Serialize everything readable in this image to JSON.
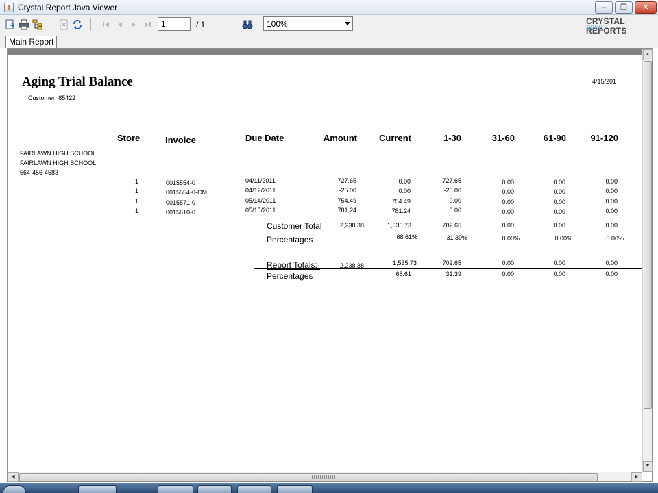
{
  "window": {
    "title": "Crystal Report Java Viewer",
    "minimize_glyph": "–",
    "maximize_glyph": "❐",
    "close_glyph": "✕"
  },
  "toolbar": {
    "icons": [
      "export-icon",
      "print-icon",
      "group-tree-icon",
      "close-view-icon",
      "refresh-icon",
      "first-page-icon",
      "previous-page-icon",
      "next-page-icon",
      "last-page-icon",
      "search-icon"
    ],
    "page_value": "1",
    "page_total": "/ 1",
    "zoom_value": "100%",
    "brand_line1": "CRYSTAL REPORTS",
    "brand_line2": "2008"
  },
  "tabs": [
    {
      "label": "Main Report"
    }
  ],
  "report": {
    "title": "Aging Trial Balance",
    "date": "4/15/201",
    "customer_param": "Customer=85422",
    "headers": [
      "Store",
      "Invoice",
      "Due Date",
      "Amount",
      "Current",
      "1-30",
      "31-60",
      "61-90",
      "91-120"
    ],
    "customer_lines": [
      "FAIRLAWN HIGH SCHOOL",
      "FAIRLAWN HIGH SCHOOL",
      "564-456-4583"
    ],
    "rows": [
      {
        "store": "1",
        "invoice": "0015554-0",
        "due": "04/11/2011",
        "amount": "727.65",
        "current": "0.00",
        "d1_30": "727.65",
        "d31_60": "0.00",
        "d61_90": "0.00",
        "d91_120": "0.00"
      },
      {
        "store": "1",
        "invoice": "0015554-0-CM",
        "due": "04/12/2011",
        "amount": "-25.00",
        "current": "0.00",
        "d1_30": "-25.00",
        "d31_60": "0.00",
        "d61_90": "0.00",
        "d91_120": "0.00"
      },
      {
        "store": "1",
        "invoice": "0015571-0",
        "due": "05/14/2011",
        "amount": "754.49",
        "current": "754.49",
        "d1_30": "0.00",
        "d31_60": "0.00",
        "d61_90": "0.00",
        "d91_120": "0.00"
      },
      {
        "store": "1",
        "invoice": "0015610-0",
        "due": "05/15/2011",
        "amount": "781.24",
        "current": "781.24",
        "d1_30": "0.00",
        "d31_60": "0.00",
        "d61_90": "0.00",
        "d91_120": "0.00"
      }
    ],
    "customer_total": {
      "label": "Customer Total",
      "amount": "2,238.38",
      "current": "1,535.73",
      "d1_30": "702.65",
      "d31_60": "0.00",
      "d61_90": "0.00",
      "d91_120": "0.00"
    },
    "customer_percentages": {
      "label": "Percentages",
      "current": "68.61%",
      "d1_30": "31.39%",
      "d31_60": "0.00%",
      "d61_90": "0.00%",
      "d91_120": "0.00%"
    },
    "report_totals": {
      "label": "Report Totals:",
      "amount": "2,238.38",
      "current": "1,535.73",
      "d1_30": "702.65",
      "d31_60": "0.00",
      "d61_90": "0.00",
      "d91_120": "0.00"
    },
    "report_percentages": {
      "label": "Percentages",
      "current": "68.61",
      "d1_30": "31.39",
      "d31_60": "0.00",
      "d61_90": "0.00",
      "d91_120": "0.00"
    }
  }
}
